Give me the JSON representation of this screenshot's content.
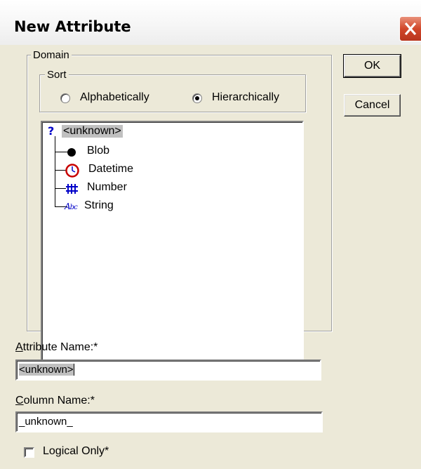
{
  "window": {
    "title": "New Attribute"
  },
  "domain_group": {
    "label": "Domain"
  },
  "sort_group": {
    "label": "Sort",
    "options": [
      {
        "label": "Alphabetically",
        "selected": false
      },
      {
        "label": "Hierarchically",
        "selected": true
      }
    ]
  },
  "tree": {
    "root": {
      "label": "<unknown>",
      "icon": "question-icon",
      "selected": true
    },
    "children": [
      {
        "label": "Blob",
        "icon": "blob-icon"
      },
      {
        "label": "Datetime",
        "icon": "clock-icon"
      },
      {
        "label": "Number",
        "icon": "number-icon"
      },
      {
        "label": "String",
        "icon": "string-icon"
      }
    ]
  },
  "buttons": {
    "ok": "OK",
    "cancel": "Cancel"
  },
  "attribute_name": {
    "label_key": "A",
    "label_rest": "ttribute Name:*",
    "value": "<unknown>"
  },
  "column_name": {
    "label_key": "C",
    "label_rest": "olumn Name:*",
    "value": "_unknown_"
  },
  "logical_only": {
    "label": "Logical Only*",
    "checked": false
  },
  "colors": {
    "close": "#d1472a",
    "selection": "#c0c0c0",
    "icon_blue": "#0000c8",
    "icon_red": "#c80000"
  }
}
